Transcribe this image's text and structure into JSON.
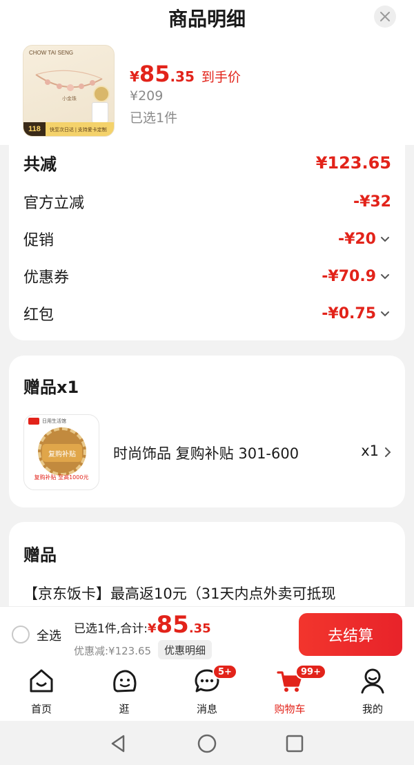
{
  "header": {
    "title": "商品明细",
    "close_icon": "close-icon"
  },
  "product": {
    "thumb_brand": "CHOW TAI SENG",
    "thumb_name": "小金珠",
    "thumb_badge": "118",
    "thumb_bar_text": "快至次日达 | 支持爱卡定制",
    "price_yen": "¥",
    "price_int": "85",
    "price_dec": ".35",
    "price_suffix": "到手价",
    "original_price": "¥209",
    "selected_count": "已选1件"
  },
  "discounts": {
    "total_label": "共减",
    "total_value": "¥123.65",
    "items": [
      {
        "label": "官方立减",
        "value": "-¥32",
        "expandable": false
      },
      {
        "label": "促销",
        "value": "-¥20",
        "expandable": true
      },
      {
        "label": "优惠券",
        "value": "-¥70.9",
        "expandable": true
      },
      {
        "label": "红包",
        "value": "-¥0.75",
        "expandable": true
      }
    ]
  },
  "gift": {
    "title": "赠品x1",
    "image_top": "日用生活馆",
    "image_seal": "复购补贴",
    "image_bottom": "复购补贴 至高1000元",
    "name": "时尚饰品 复购补贴 301-600",
    "qty": "x1"
  },
  "gift2": {
    "title": "赠品",
    "text": "【京东饭卡】最高返10元（31天内点外卖可抵现"
  },
  "checkout": {
    "select_all_label": "全选",
    "sum_label": "已选1件,合计:",
    "sum_yen": "¥",
    "sum_int": "85",
    "sum_dec": ".35",
    "saved_text": "优惠减:¥123.65",
    "detail_button": "优惠明细",
    "checkout_button": "去结算"
  },
  "nav": {
    "items": [
      {
        "label": "首页",
        "icon": "home-icon",
        "badge": ""
      },
      {
        "label": "逛",
        "icon": "explore-icon",
        "badge": ""
      },
      {
        "label": "消息",
        "icon": "message-icon",
        "badge": "5+"
      },
      {
        "label": "购物车",
        "icon": "cart-icon",
        "badge": "99+",
        "active": true
      },
      {
        "label": "我的",
        "icon": "profile-icon",
        "badge": ""
      }
    ]
  },
  "colors": {
    "accent": "#e2231a",
    "background": "#f2f2f2"
  }
}
